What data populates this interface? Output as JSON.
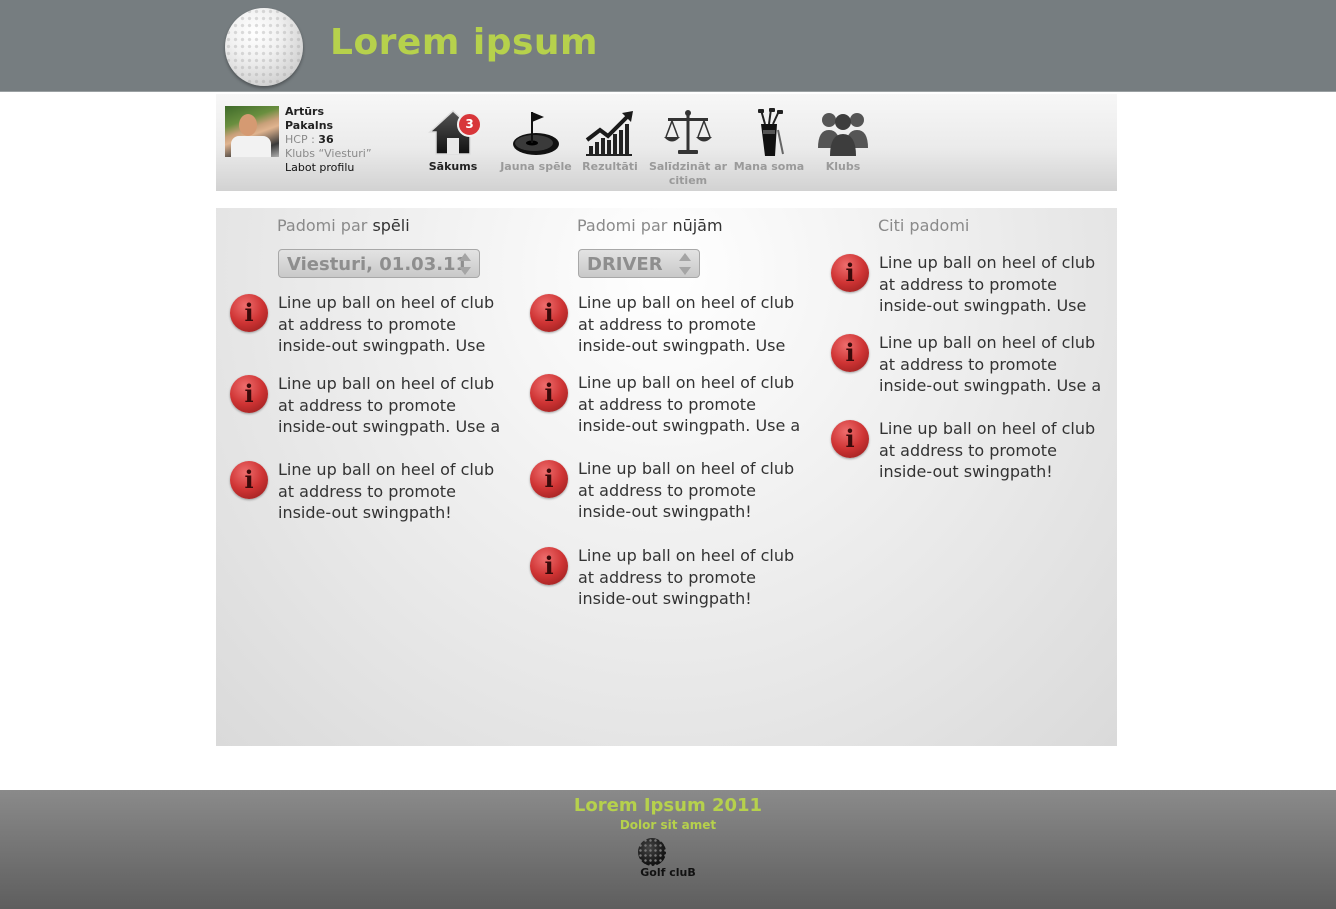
{
  "header": {
    "site_title": "Lorem ipsum"
  },
  "profile": {
    "first_name": "Artūrs",
    "last_name": "Pakalns",
    "hcp_label": "HCP :",
    "hcp_value": "36",
    "club": "Klubs “Viesturi”",
    "edit_link": "Labot profilu"
  },
  "nav": {
    "home": {
      "label": "Sākums",
      "badge": "3",
      "icon": "home-icon"
    },
    "new_game": {
      "label": "Jauna spēle",
      "icon": "golf-hole-icon"
    },
    "results": {
      "label": "Rezultāti",
      "icon": "chart-arrow-icon"
    },
    "compare": {
      "label": "Salīdzināt ar citiem",
      "icon": "scales-icon"
    },
    "bag": {
      "label": "Mana soma",
      "icon": "golf-bag-icon"
    },
    "clubs": {
      "label": "Klubs",
      "icon": "group-icon"
    }
  },
  "columns": [
    {
      "title_prefix": "Padomi par",
      "title_emph": "spēli",
      "select_value": "Viesturi, 01.03.11",
      "tips": [
        "Line up ball on heel of club\nat address to promote\ninside-out swingpath. Use",
        "Line up ball on heel of club\nat address to promote\ninside-out swingpath. Use a",
        "Line up ball on heel of club\nat address to promote\ninside-out swingpath!"
      ]
    },
    {
      "title_prefix": "Padomi par",
      "title_emph": "nūjām",
      "select_value": "DRIVER",
      "tips": [
        "Line up ball on heel of club\nat address to promote\ninside-out swingpath. Use",
        "Line up ball on heel of club\nat address to promote\ninside-out swingpath. Use a",
        "Line up ball on heel of club\nat address to promote\ninside-out swingpath!",
        "Line up ball on heel of club\nat address to promote\ninside-out swingpath!"
      ]
    },
    {
      "title_prefix": "Citi padomi",
      "tips": [
        "Line up ball on heel of club\nat address to promote\ninside-out swingpath. Use",
        "Line up ball on heel of club\nat address to promote\ninside-out swingpath. Use a",
        "Line up ball on heel of club\nat address to promote\ninside-out swingpath!"
      ]
    }
  ],
  "info_icon_glyph": "i",
  "footer": {
    "title": "Lorem Ipsum 2011",
    "subtitle": "Dolor sit amet",
    "logo_text": "Golf cluB"
  },
  "colors": {
    "accent": "#b6d14c",
    "header_bg": "#767d80",
    "badge": "#d8363a",
    "info_icon": "#cf3434"
  }
}
